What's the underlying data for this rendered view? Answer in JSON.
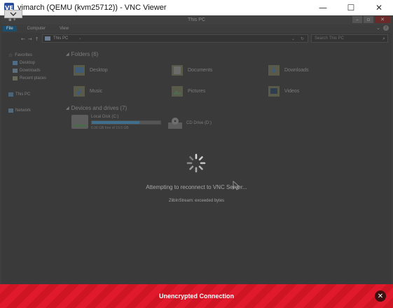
{
  "vnc_window": {
    "app_icon_text": "VE",
    "title": "vimarch (QEMU (kvm25712)) - VNC Viewer",
    "minimize_glyph": "—",
    "maximize_glyph": "☐",
    "close_glyph": "✕"
  },
  "explorer": {
    "title": "This PC",
    "ribbon": {
      "tabs": [
        "File",
        "Computer",
        "View"
      ],
      "expand_glyph": "⌄",
      "help_glyph": "?"
    },
    "address": {
      "path": "This PC",
      "search_placeholder": "Search This PC"
    },
    "nav_pane": {
      "items": [
        {
          "label": "Favorites",
          "icon": "star-icon"
        },
        {
          "label": "Desktop",
          "icon": "desktop-icon"
        },
        {
          "label": "Downloads",
          "icon": "downloads-icon"
        },
        {
          "label": "Recent places",
          "icon": "recent-places-icon"
        },
        {
          "label": "This PC",
          "icon": "computer-icon"
        },
        {
          "label": "Network",
          "icon": "network-icon"
        }
      ]
    },
    "folders_header": "Folders (6)",
    "folders": [
      {
        "label": "Desktop",
        "icon": "desktop-folder-icon"
      },
      {
        "label": "Documents",
        "icon": "documents-folder-icon"
      },
      {
        "label": "Downloads",
        "icon": "downloads-folder-icon"
      },
      {
        "label": "Music",
        "icon": "music-folder-icon"
      },
      {
        "label": "Pictures",
        "icon": "pictures-folder-icon"
      },
      {
        "label": "Videos",
        "icon": "videos-folder-icon"
      }
    ],
    "devices_header": "Devices and drives (7)",
    "drives": [
      {
        "label": "Local Disk (C:)",
        "free_text": "6.06 GB free of 19.5 GB",
        "used_fraction": 0.69
      },
      {
        "label": "CD Drive (D:)"
      }
    ]
  },
  "status": {
    "main": "Attempting to reconnect to VNC Server...",
    "sub": "ZlibInStream: exceeded bytes"
  },
  "banner": {
    "text": "Unencrypted Connection",
    "close_glyph": "✕",
    "color": "#e01a2c"
  }
}
